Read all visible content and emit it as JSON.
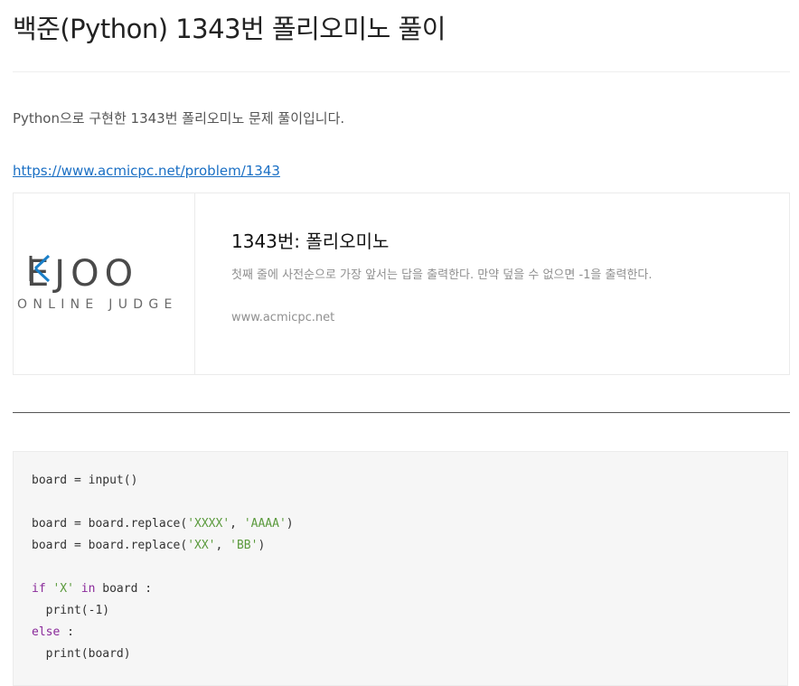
{
  "post": {
    "title": "백준(Python) 1343번 폴리오미노 풀이",
    "intro": "Python으로 구현한 1343번 폴리오미노 문제 풀이입니다.",
    "link": "https://www.acmicpc.net/problem/1343"
  },
  "og_card": {
    "logo_word_left": "E",
    "logo_word_right": "JOO",
    "logo_sub": "ONLINE JUDGE",
    "logo_accent_color": "#1a7fc8",
    "title": "1343번: 폴리오미노",
    "description": "첫째 줄에 사전순으로 가장 앞서는 답을 출력한다. 만약 덮을 수 없으면 -1을 출력한다.",
    "domain": "www.acmicpc.net"
  },
  "code": {
    "lines": [
      [
        {
          "t": "board = input()",
          "c": ""
        }
      ],
      [],
      [
        {
          "t": "board = board.replace(",
          "c": ""
        },
        {
          "t": "'XXXX'",
          "c": "str"
        },
        {
          "t": ", ",
          "c": ""
        },
        {
          "t": "'AAAA'",
          "c": "str"
        },
        {
          "t": ")",
          "c": ""
        }
      ],
      [
        {
          "t": "board = board.replace(",
          "c": ""
        },
        {
          "t": "'XX'",
          "c": "str"
        },
        {
          "t": ", ",
          "c": ""
        },
        {
          "t": "'BB'",
          "c": "str"
        },
        {
          "t": ")",
          "c": ""
        }
      ],
      [],
      [
        {
          "t": "if",
          "c": "kw"
        },
        {
          "t": " ",
          "c": ""
        },
        {
          "t": "'X'",
          "c": "str"
        },
        {
          "t": " ",
          "c": ""
        },
        {
          "t": "in",
          "c": "kw"
        },
        {
          "t": " board :",
          "c": ""
        }
      ],
      [
        {
          "t": "  print(-1)",
          "c": ""
        }
      ],
      [
        {
          "t": "else",
          "c": "kw"
        },
        {
          "t": " :",
          "c": ""
        }
      ],
      [
        {
          "t": "  print(board)",
          "c": ""
        }
      ]
    ],
    "colors": {
      "string": "#5a9a3c",
      "keyword": "#8a2a9a"
    }
  }
}
